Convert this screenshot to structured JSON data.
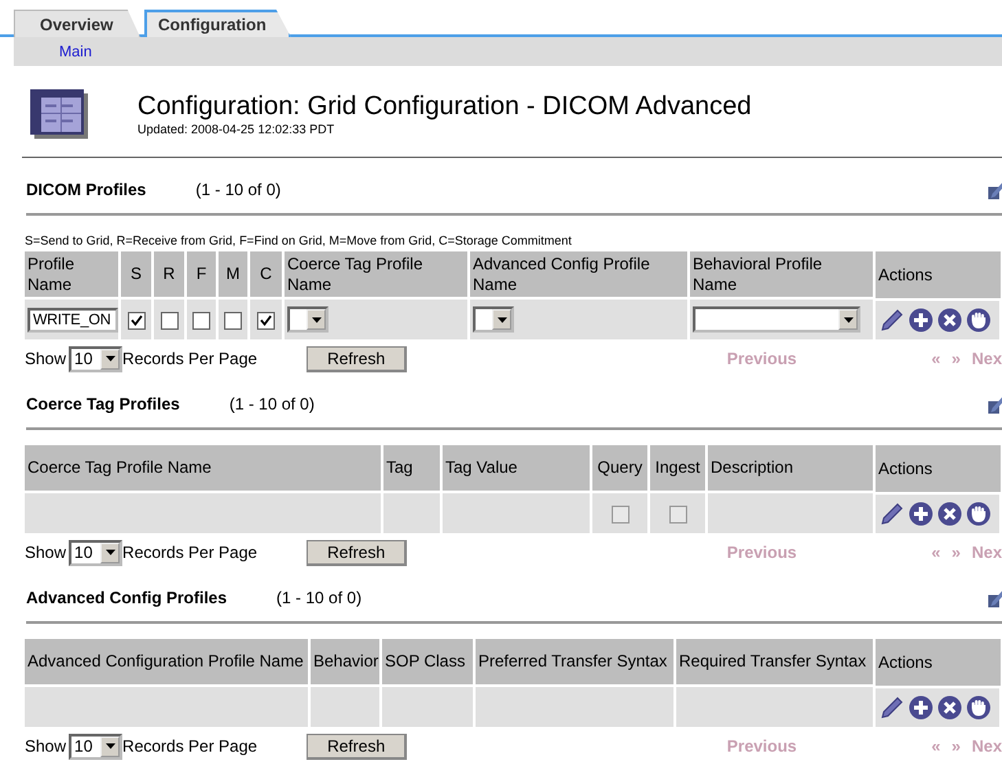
{
  "tabs": [
    {
      "label": "Overview",
      "selected": false
    },
    {
      "label": "Configuration",
      "selected": true
    }
  ],
  "subnav": {
    "links": [
      "Main"
    ]
  },
  "header": {
    "title": "Configuration: Grid Configuration - DICOM Advanced",
    "updated": "Updated: 2008-04-25 12:02:33 PDT"
  },
  "sections": [
    {
      "title": "DICOM Profiles",
      "range": "(1 - 10 of 0)",
      "legend": "S=Send to Grid, R=Receive from Grid, F=Find on Grid, M=Move from Grid, C=Storage Commitment",
      "columns": [
        "Profile Name",
        "S",
        "R",
        "F",
        "M",
        "C",
        "Coerce Tag Profile Name",
        "Advanced Config Profile Name",
        "Behavioral Profile Name",
        "Actions"
      ],
      "rows": [
        [
          {
            "kind": "input",
            "value": "WRITE_ON"
          },
          {
            "kind": "checkbox",
            "checked": true,
            "disabled": false
          },
          {
            "kind": "checkbox",
            "checked": false,
            "disabled": false
          },
          {
            "kind": "checkbox",
            "checked": false,
            "disabled": false
          },
          {
            "kind": "checkbox",
            "checked": false,
            "disabled": false
          },
          {
            "kind": "checkbox",
            "checked": true,
            "disabled": false
          },
          {
            "kind": "select"
          },
          {
            "kind": "select"
          },
          {
            "kind": "select"
          },
          {
            "kind": "actions"
          }
        ]
      ],
      "pager": {
        "show": "Show",
        "per_page": "10",
        "records": "Records Per Page",
        "refresh": "Refresh",
        "previous": {
          "label": "Previous",
          "disabled": true
        },
        "first": {
          "label": "«",
          "disabled": true
        },
        "last": {
          "label": "»",
          "disabled": true
        },
        "next": {
          "label": "Nex",
          "disabled": true
        }
      }
    },
    {
      "title": "Coerce Tag Profiles",
      "range": "(1 - 10 of 0)",
      "columns": [
        "Coerce Tag Profile Name",
        "Tag",
        "Tag Value",
        "Query",
        "Ingest",
        "Description",
        "Actions"
      ],
      "rows": [
        [
          {
            "kind": "blank"
          },
          {
            "kind": "blank"
          },
          {
            "kind": "blank"
          },
          {
            "kind": "checkbox",
            "checked": false,
            "disabled": true
          },
          {
            "kind": "checkbox",
            "checked": false,
            "disabled": true
          },
          {
            "kind": "blank"
          },
          {
            "kind": "actions"
          }
        ]
      ],
      "pager": {
        "show": "Show",
        "per_page": "10",
        "records": "Records Per Page",
        "refresh": "Refresh",
        "previous": {
          "label": "Previous",
          "disabled": true
        },
        "first": {
          "label": "«",
          "disabled": true
        },
        "last": {
          "label": "»",
          "disabled": true
        },
        "next": {
          "label": "Nex",
          "disabled": true
        }
      }
    },
    {
      "title": "Advanced Config Profiles",
      "range": "(1 - 10 of 0)",
      "columns": [
        "Advanced Configuration Profile Name",
        "Behavior",
        "SOP Class",
        "Preferred Transfer Syntax",
        "Required Transfer Syntax",
        "Actions"
      ],
      "rows": [
        [
          {
            "kind": "blank"
          },
          {
            "kind": "blank"
          },
          {
            "kind": "blank"
          },
          {
            "kind": "blank"
          },
          {
            "kind": "blank"
          },
          {
            "kind": "actions"
          }
        ]
      ],
      "pager": {
        "show": "Show",
        "per_page": "10",
        "records": "Records Per Page",
        "refresh": "Refresh",
        "previous": {
          "label": "Previous",
          "disabled": true
        },
        "first": {
          "label": "«",
          "disabled": true
        },
        "last": {
          "label": "»",
          "disabled": true
        },
        "next": {
          "label": "Nex",
          "disabled": true
        }
      }
    }
  ]
}
